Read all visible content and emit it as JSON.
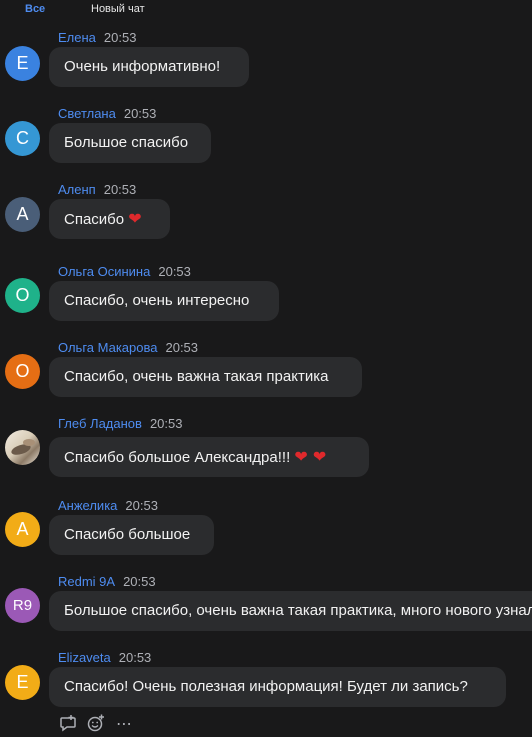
{
  "tabs": {
    "all": "Все",
    "new_chat": "Новый чат"
  },
  "colors": {
    "background": "#19191a",
    "bubble": "#2b2c2e",
    "author": "#4e8cf0",
    "heart": "#e0292c"
  },
  "messages": [
    {
      "author": "Елена",
      "time": "20:53",
      "avatar_text": "Е",
      "avatar_color": "#3a82e0",
      "text": "Очень информативно!"
    },
    {
      "author": "Светлана",
      "time": "20:53",
      "avatar_text": "С",
      "avatar_color": "#3597d4",
      "text": "Большое спасибо"
    },
    {
      "author": "Аленп",
      "time": "20:53",
      "avatar_text": "А",
      "avatar_color": "#4a5e78",
      "text": "Спасибо",
      "hearts": "❤"
    },
    {
      "author": "Ольга Осинина",
      "time": "20:53",
      "avatar_text": "О",
      "avatar_color": "#1fb28a",
      "text": "Спасибо, очень интересно"
    },
    {
      "author": "Ольга Макарова",
      "time": "20:53",
      "avatar_text": "О",
      "avatar_color": "#e56e14",
      "text": "Спасибо, очень важна такая практика"
    },
    {
      "author": "Глеб Ладанов",
      "time": "20:53",
      "avatar_text": "",
      "avatar_color": "#cfc4b2",
      "text": "Спасибо большое Александра!!!",
      "hearts": "❤ ❤"
    },
    {
      "author": "Анжелика",
      "time": "20:53",
      "avatar_text": "А",
      "avatar_color": "#f2ac17",
      "text": "Спасибо большое"
    },
    {
      "author": "Redmi 9A",
      "time": "20:53",
      "avatar_text": "R9",
      "avatar_color": "#9b59b6",
      "text": "Большое спасибо, очень важна такая практика, много нового узнала"
    },
    {
      "author": "Elizaveta",
      "time": "20:53",
      "avatar_text": "E",
      "avatar_color": "#f2ac17",
      "text": "Спасибо! Очень полезная информация! Будет ли запись?"
    }
  ],
  "actions": {
    "reply_icon": "reply-icon",
    "emoji_icon": "emoji-add-icon",
    "more_icon": "more-icon"
  }
}
